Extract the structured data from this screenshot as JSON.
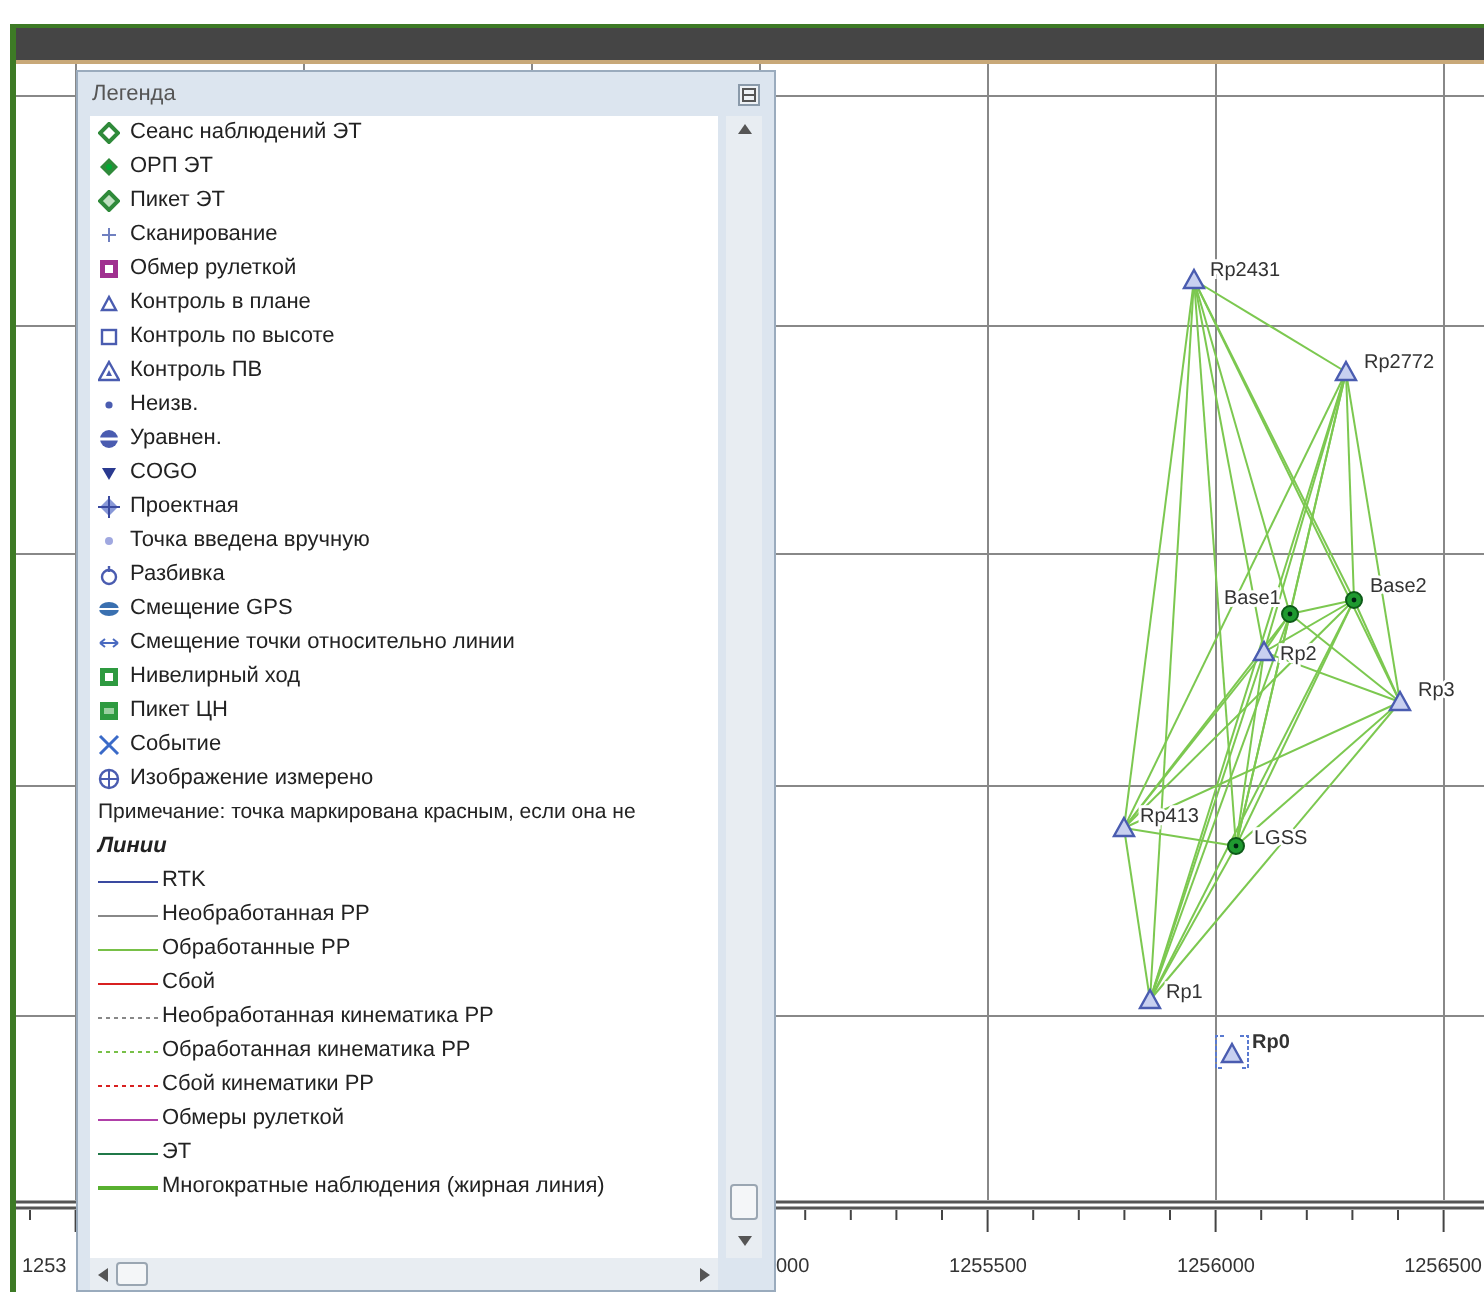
{
  "legend": {
    "title": "Легенда",
    "point_items": [
      {
        "label": "Сеанс наблюдений ЭТ"
      },
      {
        "label": "ОРП ЭТ"
      },
      {
        "label": "Пикет ЭТ"
      },
      {
        "label": "Сканирование"
      },
      {
        "label": "Обмер рулеткой"
      },
      {
        "label": "Контроль в плане"
      },
      {
        "label": "Контроль по высоте"
      },
      {
        "label": "Контроль ПВ"
      },
      {
        "label": "Неизв."
      },
      {
        "label": "Уравнен."
      },
      {
        "label": "COGO"
      },
      {
        "label": "Проектная"
      },
      {
        "label": "Точка введена вручную"
      },
      {
        "label": "Разбивка"
      },
      {
        "label": "Смещение GPS"
      },
      {
        "label": "Смещение точки относительно линии"
      },
      {
        "label": "Нивелирный ход"
      },
      {
        "label": "Пикет ЦН"
      },
      {
        "label": "Событие"
      },
      {
        "label": "Изображение измерено"
      }
    ],
    "note": "Примечание: точка маркирована красным, если она не",
    "lines_heading": "Линии",
    "line_items": [
      {
        "label": "RTK",
        "color": "#3a4aa0",
        "kind": "solid"
      },
      {
        "label": "Необработанная PP",
        "color": "#888888",
        "kind": "solid"
      },
      {
        "label": "Обработанные PP",
        "color": "#78c048",
        "kind": "solid"
      },
      {
        "label": "Сбой",
        "color": "#d82020",
        "kind": "solid"
      },
      {
        "label": "Необработанная кинематика PP",
        "color": "#888888",
        "kind": "dashed"
      },
      {
        "label": "Обработанная кинематика PP",
        "color": "#78c048",
        "kind": "dashed"
      },
      {
        "label": "Сбой кинематики PP",
        "color": "#d82020",
        "kind": "dashed"
      },
      {
        "label": "Обмеры рулеткой",
        "color": "#b040a8",
        "kind": "solid"
      },
      {
        "label": "ЭТ",
        "color": "#207848",
        "kind": "solid"
      },
      {
        "label": "Многократные наблюдения (жирная линия)",
        "color": "#58b030",
        "kind": "bold"
      }
    ]
  },
  "map": {
    "points": [
      {
        "label": "Rp2431",
        "kind": "control",
        "selected": false
      },
      {
        "label": "Rp2772",
        "kind": "control",
        "selected": false
      },
      {
        "label": "Base2",
        "kind": "base",
        "selected": false
      },
      {
        "label": "Base1",
        "kind": "base",
        "selected": false
      },
      {
        "label": "Rp2",
        "kind": "control",
        "selected": false
      },
      {
        "label": "Rp3",
        "kind": "control",
        "selected": false
      },
      {
        "label": "Rp413",
        "kind": "control",
        "selected": false
      },
      {
        "label": "LGSS",
        "kind": "base",
        "selected": false
      },
      {
        "label": "Rp1",
        "kind": "control",
        "selected": false
      },
      {
        "label": "Rp0",
        "kind": "control",
        "selected": true
      }
    ],
    "x_axis_labels": [
      "1253",
      "000",
      "1255500",
      "1256000",
      "1256500"
    ]
  }
}
